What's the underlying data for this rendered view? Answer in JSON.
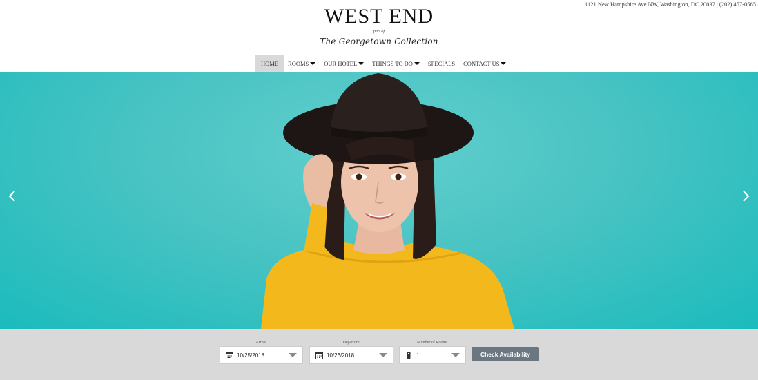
{
  "header": {
    "address_line": "1121 New Hampshire Ave NW, Washington, DC 20037 | (202) 457-0565",
    "logo_title": "WEST END",
    "logo_part_of": "part of",
    "logo_collection": "The Georgetown Collection"
  },
  "nav": {
    "items": [
      {
        "label": "HOME",
        "has_dropdown": false,
        "active": true
      },
      {
        "label": "ROOMS",
        "has_dropdown": true
      },
      {
        "label": "OUR HOTEL",
        "has_dropdown": true
      },
      {
        "label": "THINGS TO DO",
        "has_dropdown": true
      },
      {
        "label": "SPECIALS",
        "has_dropdown": false
      },
      {
        "label": "CONTACT US",
        "has_dropdown": true
      }
    ]
  },
  "hero": {
    "background_color": "#49c3c3",
    "prev_icon": "chevron-left-icon",
    "next_icon": "chevron-right-icon"
  },
  "booking": {
    "arrive_label": "Arrive",
    "arrive_value": "10/25/2018",
    "departure_label": "Departure",
    "departure_value": "10/26/2018",
    "rooms_label": "Number of Rooms",
    "rooms_value": "1",
    "check_button": "Check Availability",
    "button_color": "#6a7680"
  }
}
